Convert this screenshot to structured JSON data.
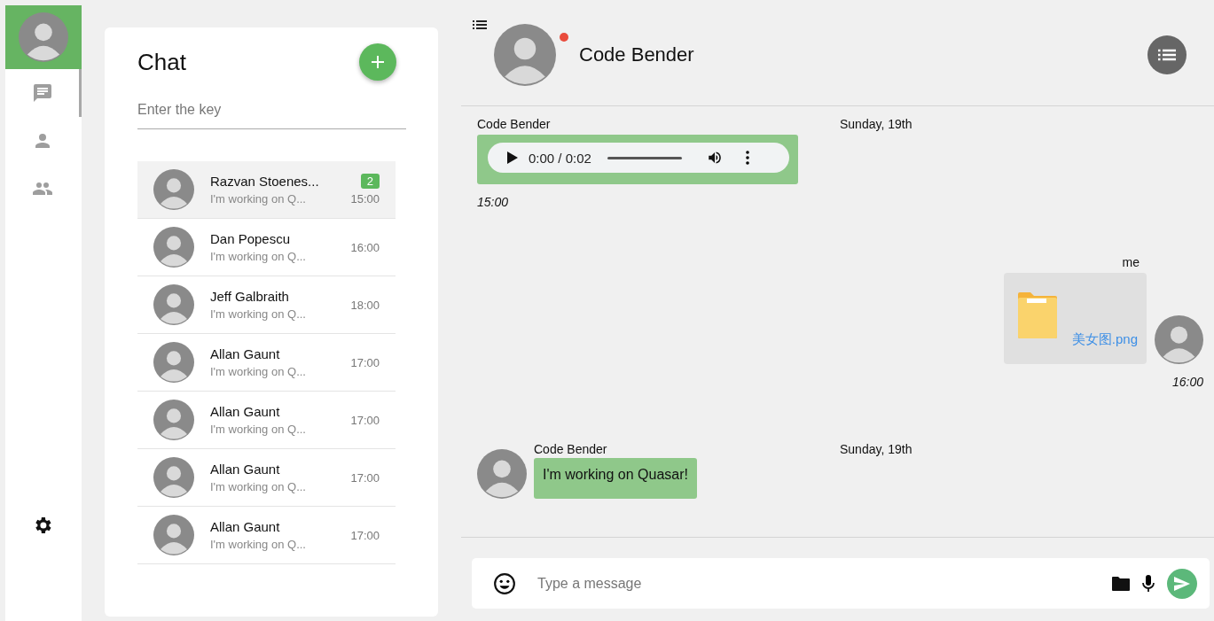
{
  "nav": [
    {
      "kind": "chat",
      "selected": true
    },
    {
      "kind": "person",
      "selected": false
    },
    {
      "kind": "people",
      "selected": false
    }
  ],
  "chat_list": {
    "title": "Chat",
    "search": {
      "placeholder": "Enter the key"
    },
    "conversations": [
      {
        "name": "Razvan Stoenes...",
        "preview": "I'm working on Q...",
        "time": "15:00",
        "unread": "2",
        "selected": true
      },
      {
        "name": "Dan Popescu",
        "preview": "I'm working on Q...",
        "time": "16:00",
        "selected": false
      },
      {
        "name": "Jeff Galbraith",
        "preview": "I'm working on Q...",
        "time": "18:00",
        "selected": false
      },
      {
        "name": "Allan Gaunt",
        "preview": "I'm working on Q...",
        "time": "17:00",
        "selected": false
      },
      {
        "name": "Allan Gaunt",
        "preview": "I'm working on Q...",
        "time": "17:00",
        "selected": false
      },
      {
        "name": "Allan Gaunt",
        "preview": "I'm working on Q...",
        "time": "17:00",
        "selected": false
      },
      {
        "name": "Allan Gaunt",
        "preview": "I'm working on Q...",
        "time": "17:00",
        "selected": false
      }
    ]
  },
  "conversation": {
    "contact": {
      "name": "Code Bender",
      "notification": true
    },
    "messages": [
      {
        "kind": "audio",
        "outgoing": false,
        "show_avatar": false,
        "sender": "Code Bender",
        "date": "Sunday, 19th",
        "playback": "0:00 / 0:02",
        "time": "15:00"
      },
      {
        "kind": "file",
        "outgoing": true,
        "show_avatar": true,
        "sender": "me",
        "file_name": "美女图.png",
        "time": "16:00"
      },
      {
        "kind": "text",
        "outgoing": false,
        "show_avatar": true,
        "sender": "Code Bender",
        "date": "Sunday, 19th",
        "text": "I'm working on Quasar!"
      }
    ],
    "composer": {
      "placeholder": "Type a message"
    }
  }
}
